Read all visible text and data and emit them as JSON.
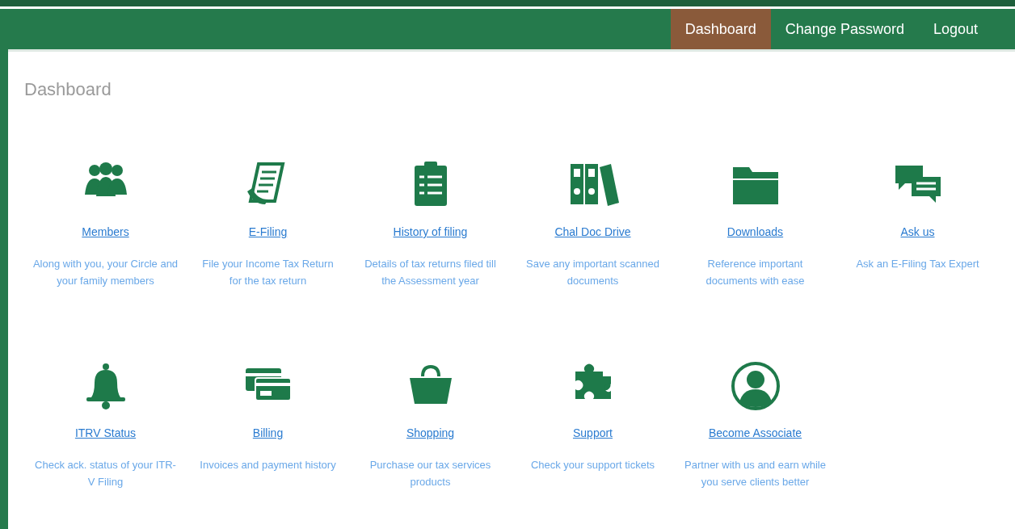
{
  "nav": [
    {
      "label": "Dashboard",
      "selected": true
    },
    {
      "label": "Change Password",
      "selected": false
    },
    {
      "label": "Logout",
      "selected": false
    }
  ],
  "heading": "Dashboard",
  "tiles": [
    {
      "kind": "people",
      "title": "Members",
      "description": "Along with you, your Circle and your family members"
    },
    {
      "kind": "document",
      "title": "E-Filing",
      "description": "File your Income Tax Return for the tax return"
    },
    {
      "kind": "clipboard",
      "title": "History of filing",
      "description": "Details of tax returns filed till the Assessment year"
    },
    {
      "kind": "binders",
      "title": "Chal Doc Drive",
      "description": "Save any important scanned documents"
    },
    {
      "kind": "folder",
      "title": "Downloads",
      "description": "Reference important documents with ease"
    },
    {
      "kind": "chat",
      "title": "Ask us",
      "description": "Ask an E-Filing Tax Expert"
    },
    {
      "kind": "bell",
      "title": "ITRV Status",
      "description": "Check ack. status of your ITR-V Filing"
    },
    {
      "kind": "cards",
      "title": "Billing",
      "description": "Invoices and payment history"
    },
    {
      "kind": "bag",
      "title": "Shopping",
      "description": "Purchase our tax services products"
    },
    {
      "kind": "puzzle",
      "title": "Support",
      "description": "Check your support tickets"
    },
    {
      "kind": "person",
      "title": "Become Associate",
      "description": "Partner with us and earn while you serve clients better"
    }
  ]
}
